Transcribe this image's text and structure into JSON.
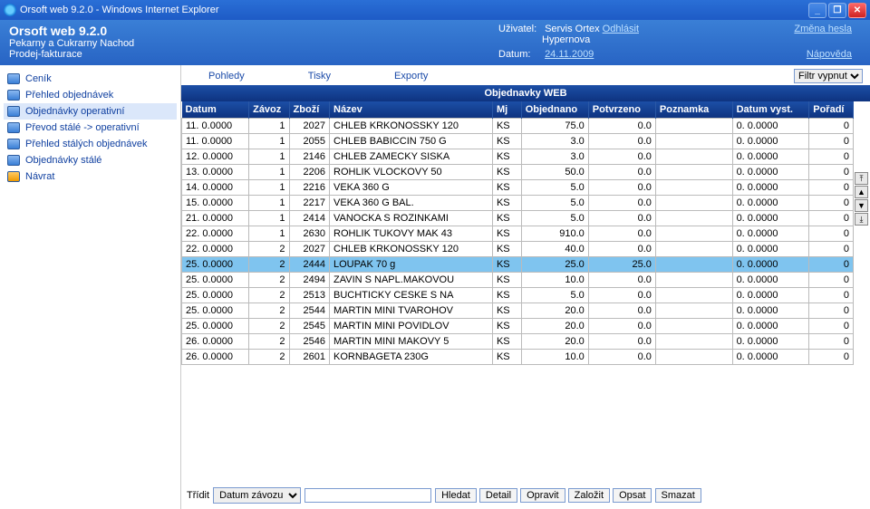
{
  "window": {
    "title": "Orsoft web 9.2.0 - Windows Internet Explorer"
  },
  "header": {
    "app_title": "Orsoft web 9.2.0",
    "subtitle": "Pekarny a Cukrarny Nachod",
    "section": "Prodej-fakturace",
    "user_label": "Uživatel:",
    "user_name": "Servis Ortex",
    "logout": "Odhlásit",
    "user_sub": "Hypernova",
    "date_label": "Datum:",
    "date": "24.11.2009",
    "change_pw": "Změna hesla",
    "help": "Nápověda"
  },
  "sidebar": {
    "items": [
      {
        "label": "Ceník"
      },
      {
        "label": "Přehled objednávek"
      },
      {
        "label": "Objednávky operativní"
      },
      {
        "label": "Převod stálé -> operativní"
      },
      {
        "label": "Přehled stálých objednávek"
      },
      {
        "label": "Objednávky stálé"
      },
      {
        "label": "Návrat"
      }
    ]
  },
  "toolbar2": {
    "views": "Pohledy",
    "prints": "Tisky",
    "exports": "Exporty"
  },
  "filter": {
    "option": "Filtr vypnut"
  },
  "table": {
    "title": "Objednavky WEB",
    "cols": [
      "Datum",
      "Závoz",
      "Zboží",
      "Název",
      "Mj",
      "Objednano",
      "Potvrzeno",
      "Poznamka",
      "Datum vyst.",
      "Pořadí"
    ],
    "rows": [
      {
        "datum": "11. 0.0000",
        "zavoz": "1",
        "zbozi": "2027",
        "nazev": "CHLEB KRKONOSSKY 120",
        "mj": "KS",
        "obj": "75.0",
        "potv": "0.0",
        "pozn": "",
        "vyst": "0. 0.0000",
        "por": "0"
      },
      {
        "datum": "11. 0.0000",
        "zavoz": "1",
        "zbozi": "2055",
        "nazev": "CHLEB BABICCIN 750 G",
        "mj": "KS",
        "obj": "3.0",
        "potv": "0.0",
        "pozn": "",
        "vyst": "0. 0.0000",
        "por": "0"
      },
      {
        "datum": "12. 0.0000",
        "zavoz": "1",
        "zbozi": "2146",
        "nazev": "CHLEB ZAMECKY SISKA",
        "mj": "KS",
        "obj": "3.0",
        "potv": "0.0",
        "pozn": "",
        "vyst": "0. 0.0000",
        "por": "0"
      },
      {
        "datum": "13. 0.0000",
        "zavoz": "1",
        "zbozi": "2206",
        "nazev": "ROHLIK VLOCKOVY 50",
        "mj": "KS",
        "obj": "50.0",
        "potv": "0.0",
        "pozn": "",
        "vyst": "0. 0.0000",
        "por": "0"
      },
      {
        "datum": "14. 0.0000",
        "zavoz": "1",
        "zbozi": "2216",
        "nazev": "VEKA 360 G",
        "mj": "KS",
        "obj": "5.0",
        "potv": "0.0",
        "pozn": "",
        "vyst": "0. 0.0000",
        "por": "0"
      },
      {
        "datum": "15. 0.0000",
        "zavoz": "1",
        "zbozi": "2217",
        "nazev": "VEKA 360 G BAL.",
        "mj": "KS",
        "obj": "5.0",
        "potv": "0.0",
        "pozn": "",
        "vyst": "0. 0.0000",
        "por": "0"
      },
      {
        "datum": "21. 0.0000",
        "zavoz": "1",
        "zbozi": "2414",
        "nazev": "VANOCKA S ROZINKAMI",
        "mj": "KS",
        "obj": "5.0",
        "potv": "0.0",
        "pozn": "",
        "vyst": "0. 0.0000",
        "por": "0"
      },
      {
        "datum": "22. 0.0000",
        "zavoz": "1",
        "zbozi": "2630",
        "nazev": "ROHLIK TUKOVY MAK 43",
        "mj": "KS",
        "obj": "910.0",
        "potv": "0.0",
        "pozn": "",
        "vyst": "0. 0.0000",
        "por": "0"
      },
      {
        "datum": "22. 0.0000",
        "zavoz": "2",
        "zbozi": "2027",
        "nazev": "CHLEB KRKONOSSKY 120",
        "mj": "KS",
        "obj": "40.0",
        "potv": "0.0",
        "pozn": "",
        "vyst": "0. 0.0000",
        "por": "0"
      },
      {
        "datum": "25. 0.0000",
        "zavoz": "2",
        "zbozi": "2444",
        "nazev": "LOUPAK 70 g",
        "mj": "KS",
        "obj": "25.0",
        "potv": "25.0",
        "pozn": "",
        "vyst": "0. 0.0000",
        "por": "0",
        "sel": true
      },
      {
        "datum": "25. 0.0000",
        "zavoz": "2",
        "zbozi": "2494",
        "nazev": "ZAVIN S NAPL.MAKOVOU",
        "mj": "KS",
        "obj": "10.0",
        "potv": "0.0",
        "pozn": "",
        "vyst": "0. 0.0000",
        "por": "0"
      },
      {
        "datum": "25. 0.0000",
        "zavoz": "2",
        "zbozi": "2513",
        "nazev": "BUCHTICKY CESKE S NA",
        "mj": "KS",
        "obj": "5.0",
        "potv": "0.0",
        "pozn": "",
        "vyst": "0. 0.0000",
        "por": "0"
      },
      {
        "datum": "25. 0.0000",
        "zavoz": "2",
        "zbozi": "2544",
        "nazev": "MARTIN MINI TVAROHOV",
        "mj": "KS",
        "obj": "20.0",
        "potv": "0.0",
        "pozn": "",
        "vyst": "0. 0.0000",
        "por": "0"
      },
      {
        "datum": "25. 0.0000",
        "zavoz": "2",
        "zbozi": "2545",
        "nazev": "MARTIN MINI POVIDLOV",
        "mj": "KS",
        "obj": "20.0",
        "potv": "0.0",
        "pozn": "",
        "vyst": "0. 0.0000",
        "por": "0"
      },
      {
        "datum": "26. 0.0000",
        "zavoz": "2",
        "zbozi": "2546",
        "nazev": "MARTIN MINI MAKOVY 5",
        "mj": "KS",
        "obj": "20.0",
        "potv": "0.0",
        "pozn": "",
        "vyst": "0. 0.0000",
        "por": "0"
      },
      {
        "datum": "26. 0.0000",
        "zavoz": "2",
        "zbozi": "2601",
        "nazev": "KORNBAGETA 230G",
        "mj": "KS",
        "obj": "10.0",
        "potv": "0.0",
        "pozn": "",
        "vyst": "0. 0.0000",
        "por": "0"
      }
    ]
  },
  "footer": {
    "sort_label": "Třídit",
    "sort_option": "Datum závozu",
    "buttons": [
      "Hledat",
      "Detail",
      "Opravit",
      "Založit",
      "Opsat",
      "Smazat"
    ]
  }
}
